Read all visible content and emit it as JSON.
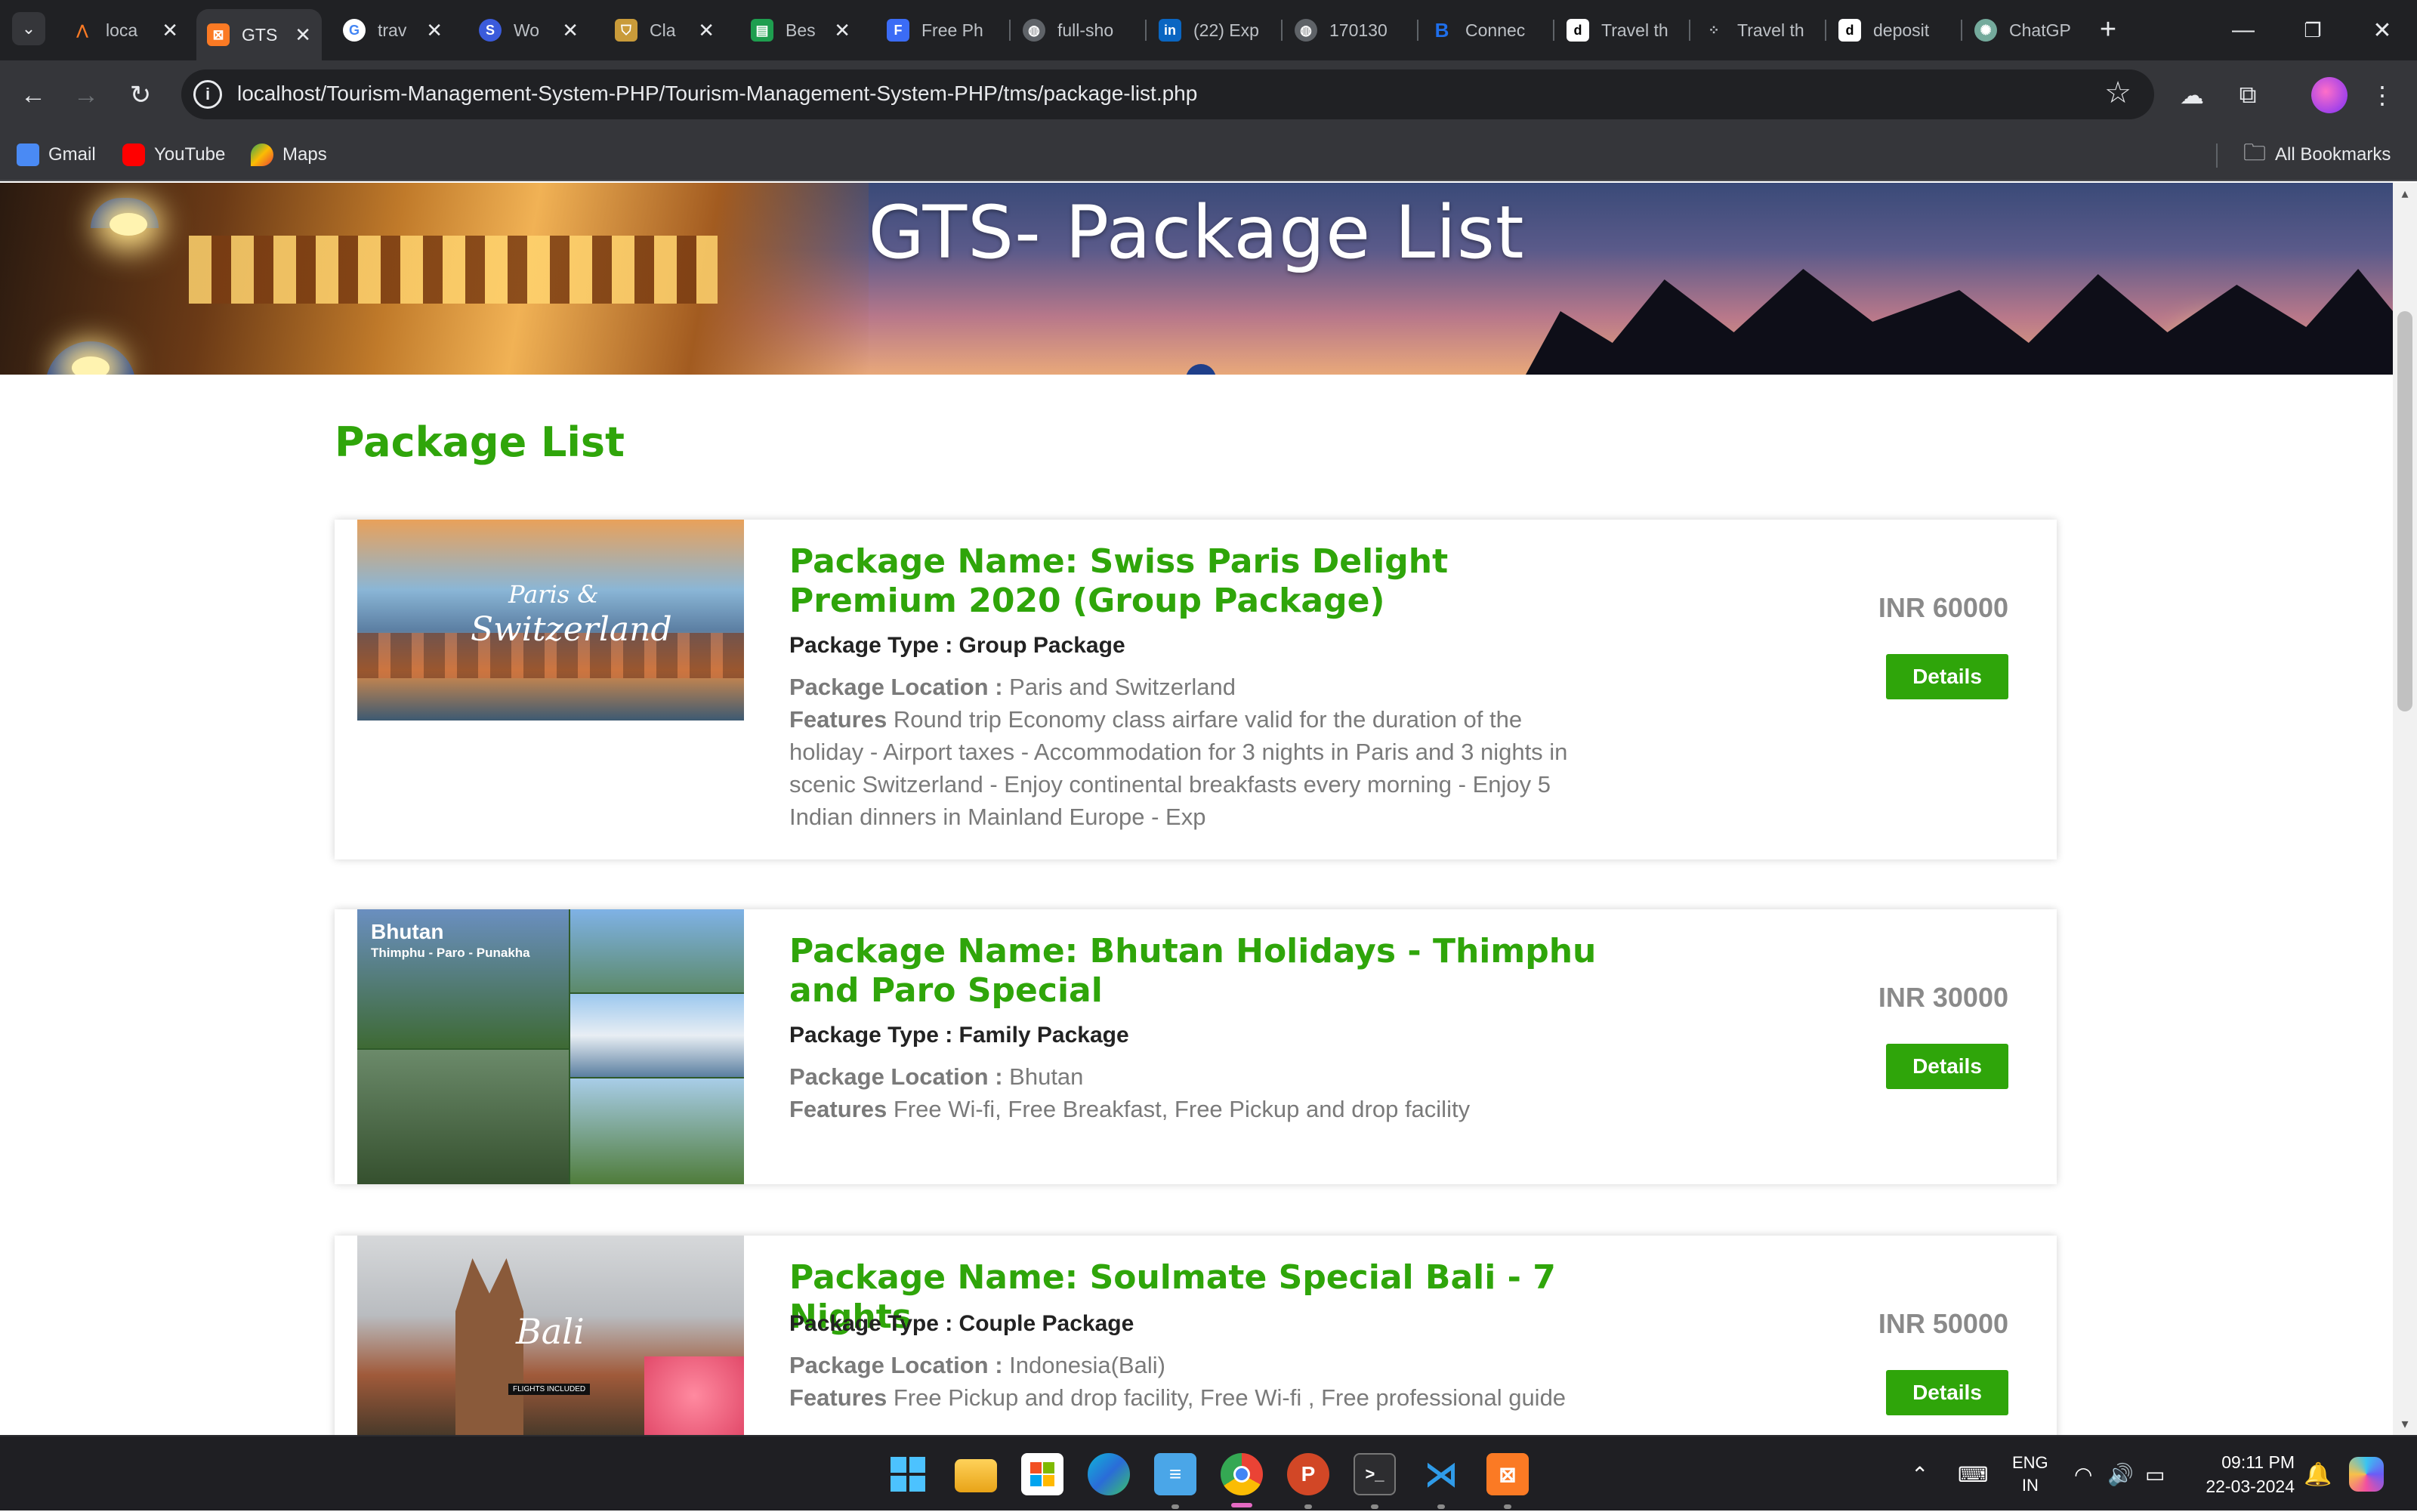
{
  "browser": {
    "tabs": [
      {
        "title": "loca",
        "favicon": "xampp-icon",
        "color": "#fb7a24"
      },
      {
        "title": "GTS",
        "favicon": "xampp-icon",
        "color": "#fb7a24",
        "active": true
      },
      {
        "title": "trav",
        "favicon": "google-icon",
        "color": "#4285f4"
      },
      {
        "title": "Wo",
        "favicon": "globe-icon",
        "color": "#3b5bdb"
      },
      {
        "title": "Cla",
        "favicon": "shield-icon",
        "color": "#c99b3a"
      },
      {
        "title": "Bes",
        "favicon": "sheet-icon",
        "color": "#1e9e4f"
      },
      {
        "title": "Free Ph",
        "favicon": "f-icon",
        "color": "#3b6cf6"
      },
      {
        "title": "full-sho",
        "favicon": "globe-icon",
        "color": "#9aa0a6"
      },
      {
        "title": "(22) Exp",
        "favicon": "linkedin-icon",
        "color": "#0a66c2"
      },
      {
        "title": "170130",
        "favicon": "globe-icon",
        "color": "#9aa0a6"
      },
      {
        "title": "Connec",
        "favicon": "b-icon",
        "color": "#1f6feb"
      },
      {
        "title": "Travel th",
        "favicon": "d-icon",
        "color": "#ffffff"
      },
      {
        "title": "Travel th",
        "favicon": "dots-icon",
        "color": "#9aa0a6"
      },
      {
        "title": "deposit",
        "favicon": "d-icon",
        "color": "#ffffff"
      },
      {
        "title": "ChatGP",
        "favicon": "chatgpt-icon",
        "color": "#74aa9c"
      }
    ],
    "url": "localhost/Tourism-Management-System-PHP/Tourism-Management-System-PHP/tms/package-list.php",
    "bookmarks": [
      {
        "label": "Gmail",
        "icon": "gmail-icon"
      },
      {
        "label": "YouTube",
        "icon": "youtube-icon"
      },
      {
        "label": "Maps",
        "icon": "maps-icon"
      }
    ],
    "all_bookmarks": "All Bookmarks"
  },
  "page": {
    "hero_title": "GTS- Package List",
    "section_heading": "Package List",
    "packages": [
      {
        "name": "Package Name: Swiss Paris Delight Premium 2020 (Group Package)",
        "type": "Package Type : Group Package",
        "location_label": "Package Location :",
        "location": "Paris and Switzerland",
        "features_label": "Features",
        "features": "Round trip Economy class airfare valid for the duration of the holiday - Airport taxes - Accommodation for 3 nights in Paris and 3 nights in scenic Switzerland - Enjoy continental breakfasts every morning - Enjoy 5 Indian dinners in Mainland Europe - Exp",
        "price": "INR 60000",
        "details_label": "Details",
        "image_text_1": "Paris &",
        "image_text_2": "Switzerland"
      },
      {
        "name": "Package Name: Bhutan Holidays - Thimphu and Paro Special",
        "type": "Package Type : Family Package",
        "location_label": "Package Location :",
        "location": "Bhutan",
        "features_label": "Features",
        "features": "Free Wi-fi, Free Breakfast, Free Pickup and drop facility",
        "price": "INR 30000",
        "details_label": "Details",
        "image_text_1": "Bhutan",
        "image_text_2": "Thimphu - Paro - Punakha"
      },
      {
        "name": "Package Name: Soulmate Special Bali - 7 Nights",
        "type": "Package Type : Couple Package",
        "location_label": "Package Location :",
        "location": "Indonesia(Bali)",
        "features_label": "Features",
        "features": "Free Pickup and drop facility, Free Wi-fi , Free professional guide",
        "price": "INR 50000",
        "details_label": "Details",
        "image_text_1": "Bali",
        "image_text_2": "FLIGHTS INCLUDED"
      }
    ]
  },
  "taskbar": {
    "language": "ENG",
    "region": "IN",
    "time": "09:11 PM",
    "date": "22-03-2024"
  },
  "colors": {
    "accent_green": "#2fa50a",
    "chrome_dark": "#202124",
    "chrome_mid": "#35363a"
  }
}
